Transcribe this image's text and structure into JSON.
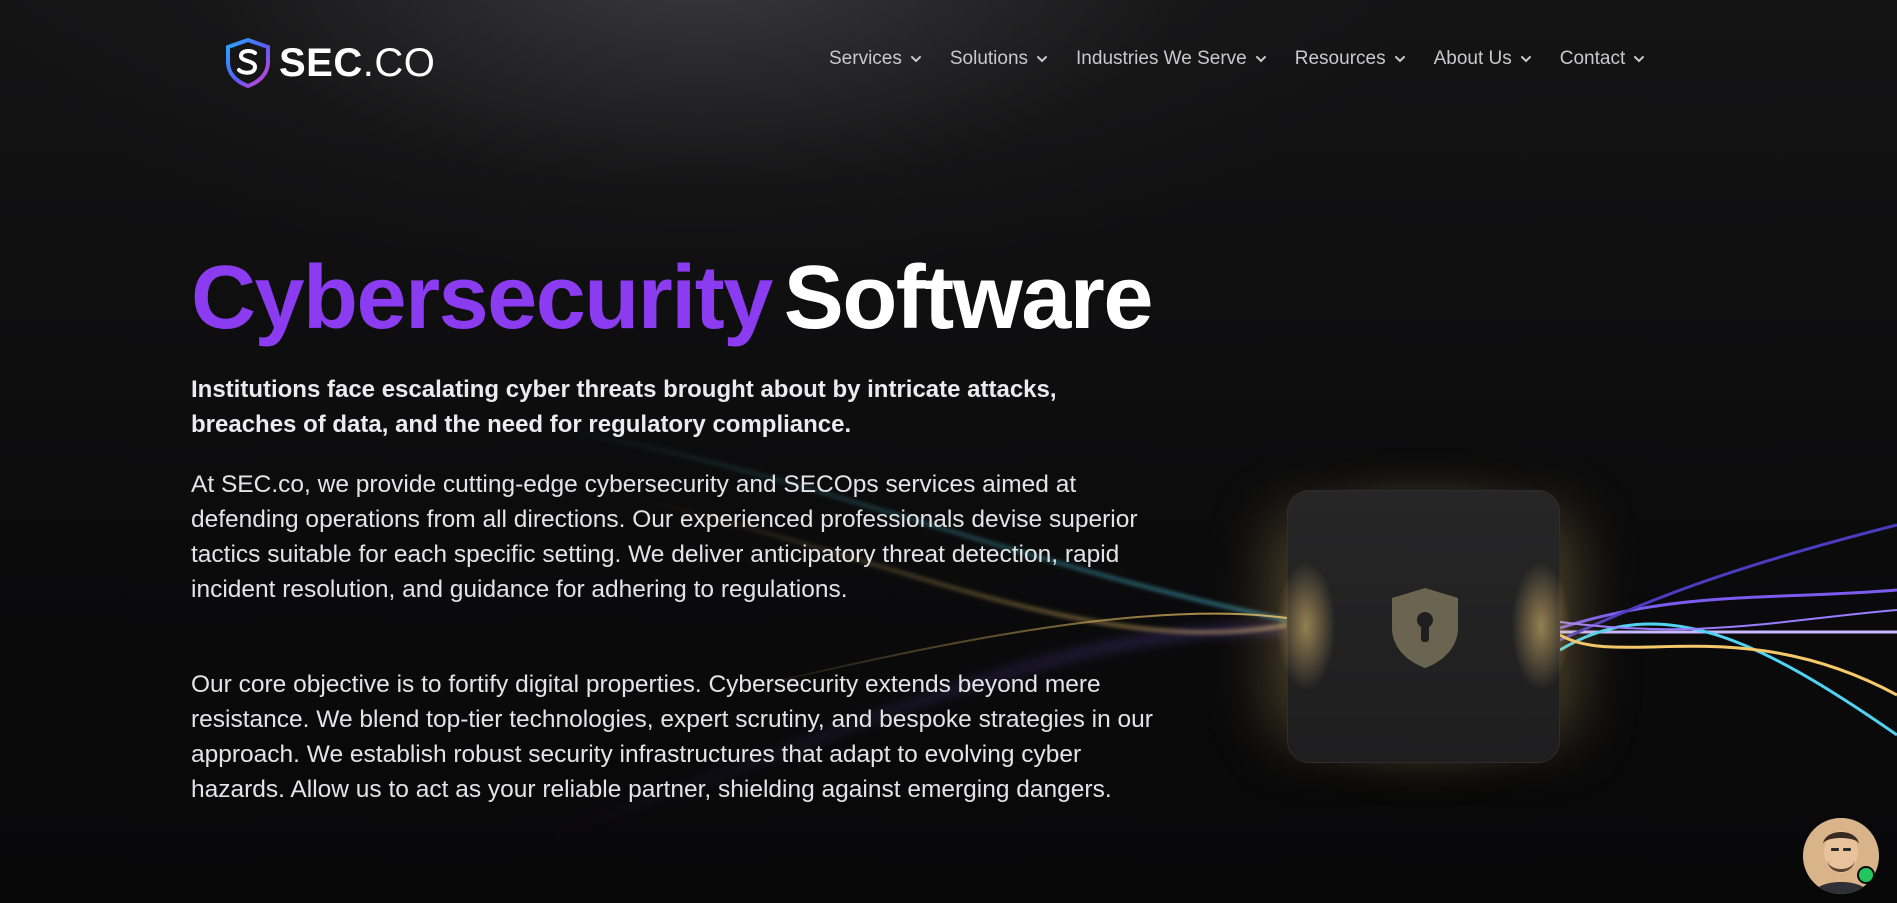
{
  "brand": {
    "logo_bold": "SEC",
    "logo_rest": ".CO",
    "icon": "shield-s-logo-icon"
  },
  "nav": {
    "items": [
      {
        "label": "Services"
      },
      {
        "label": "Solutions"
      },
      {
        "label": "Industries We Serve"
      },
      {
        "label": "Resources"
      },
      {
        "label": "About Us"
      },
      {
        "label": "Contact"
      }
    ],
    "chevron_icon": "chevron-down-icon"
  },
  "hero": {
    "title_highlight": "Cybersecurity",
    "title_rest": "Software",
    "lead": "Institutions face escalating cyber threats brought about by intricate attacks, breaches of data, and the need for regulatory compliance.",
    "paragraph_1": "At SEC.co, we provide cutting-edge cybersecurity and SECOps services aimed at defending operations from all directions. Our experienced professionals devise superior tactics suitable for each specific setting. We deliver anticipatory threat detection, rapid incident resolution, and guidance for adhering to regulations.",
    "paragraph_2": "Our core objective is to fortify digital properties. Cybersecurity extends beyond mere resistance. We blend top-tier technologies, expert scrutiny, and bespoke strategies in our approach. We establish robust security infrastructures that adapt to evolving cyber hazards. Allow us to act as your reliable partner, shielding against emerging dangers."
  },
  "visual": {
    "card_icon": "shield-lock-icon"
  },
  "chat": {
    "avatar_icon": "agent-avatar",
    "status": "online"
  },
  "colors": {
    "accent_purple": "#8b3cf0",
    "background": "#0b0b0c",
    "beam_yellow": "#f5c86a",
    "beam_cyan": "#4fd3f0",
    "beam_violet": "#7c5cf0",
    "online_green": "#22c55e"
  }
}
